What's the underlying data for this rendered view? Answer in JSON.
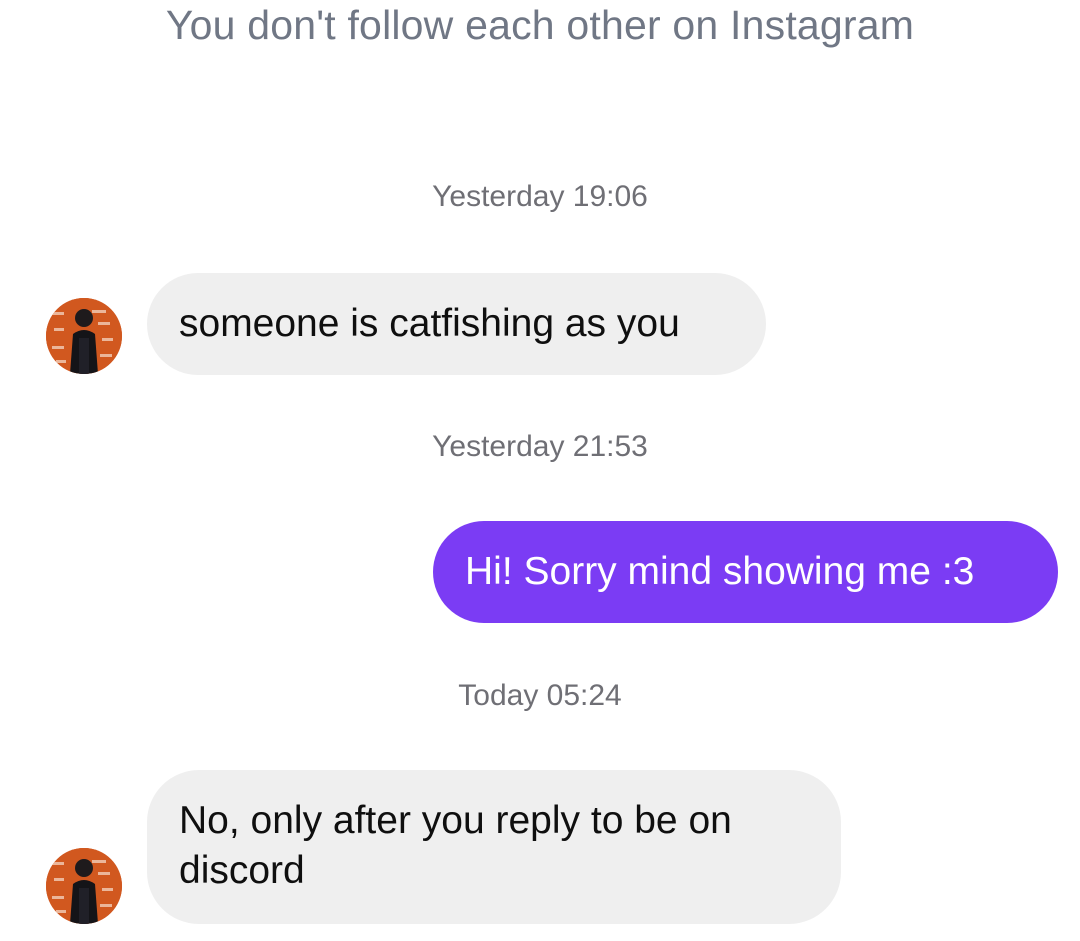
{
  "header": {
    "follow_status": "You don't follow each other on Instagram"
  },
  "thread": {
    "timestamps": [
      "Yesterday 19:06",
      "Yesterday 21:53",
      "Today 05:24"
    ],
    "messages": [
      {
        "direction": "incoming",
        "text": "someone is catfishing as you"
      },
      {
        "direction": "outgoing",
        "text": "Hi! Sorry mind showing me :3"
      },
      {
        "direction": "incoming",
        "text": "No, only after you reply to be on discord"
      }
    ]
  },
  "colors": {
    "outgoing_bubble": "#7b3cf4",
    "incoming_bubble": "#efefef",
    "meta_text": "#6f6f75",
    "avatar_background": "#d1581f"
  },
  "icons": {
    "avatar": "profile-photo"
  }
}
